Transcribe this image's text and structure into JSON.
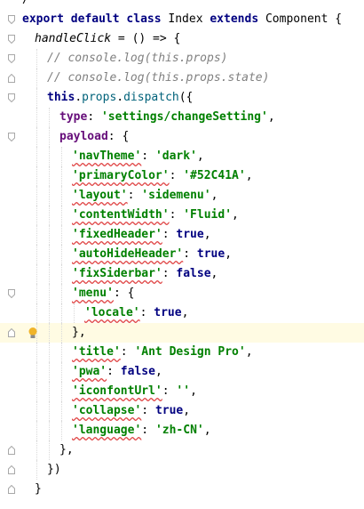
{
  "editor": {
    "active_line_index": 17,
    "lines": [
      {
        "indent": 0,
        "fold": "none",
        "tokens": [
          {
            "t": "/",
            "c": "plain"
          }
        ]
      },
      {
        "indent": 0,
        "fold": "open",
        "tokens": [
          {
            "t": "export",
            "c": "kw"
          },
          {
            "t": " ",
            "c": "plain"
          },
          {
            "t": "default",
            "c": "kw"
          },
          {
            "t": " ",
            "c": "plain"
          },
          {
            "t": "class",
            "c": "kw"
          },
          {
            "t": " Index ",
            "c": "plain"
          },
          {
            "t": "extends",
            "c": "kw"
          },
          {
            "t": " Component {",
            "c": "plain"
          }
        ]
      },
      {
        "indent": 1,
        "fold": "open",
        "tokens": [
          {
            "t": "handleClick",
            "c": "param"
          },
          {
            "t": " = () => {",
            "c": "plain"
          }
        ]
      },
      {
        "indent": 2,
        "fold": "open",
        "tokens": [
          {
            "t": "// console.log(this.props)",
            "c": "comment"
          }
        ]
      },
      {
        "indent": 2,
        "fold": "close",
        "tokens": [
          {
            "t": "// console.log(this.props.state)",
            "c": "comment"
          }
        ]
      },
      {
        "indent": 2,
        "fold": "open",
        "tokens": [
          {
            "t": "this",
            "c": "kw"
          },
          {
            "t": ".",
            "c": "plain"
          },
          {
            "t": "props",
            "c": "fn"
          },
          {
            "t": ".",
            "c": "plain"
          },
          {
            "t": "dispatch",
            "c": "fn"
          },
          {
            "t": "({",
            "c": "plain"
          }
        ]
      },
      {
        "indent": 3,
        "fold": "none",
        "tokens": [
          {
            "t": "type",
            "c": "key"
          },
          {
            "t": ": ",
            "c": "plain"
          },
          {
            "t": "'settings/changeSetting'",
            "c": "str"
          },
          {
            "t": ",",
            "c": "plain"
          }
        ]
      },
      {
        "indent": 3,
        "fold": "open",
        "tokens": [
          {
            "t": "payload",
            "c": "key"
          },
          {
            "t": ": {",
            "c": "plain"
          }
        ]
      },
      {
        "indent": 4,
        "fold": "none",
        "tokens": [
          {
            "t": "'navTheme'",
            "c": "str",
            "w": true
          },
          {
            "t": ": ",
            "c": "plain"
          },
          {
            "t": "'dark'",
            "c": "str"
          },
          {
            "t": ",",
            "c": "plain"
          }
        ]
      },
      {
        "indent": 4,
        "fold": "none",
        "tokens": [
          {
            "t": "'primaryColor'",
            "c": "str",
            "w": true
          },
          {
            "t": ": ",
            "c": "plain"
          },
          {
            "t": "'#52C41A'",
            "c": "str"
          },
          {
            "t": ",",
            "c": "plain"
          }
        ]
      },
      {
        "indent": 4,
        "fold": "none",
        "tokens": [
          {
            "t": "'layout'",
            "c": "str",
            "w": true
          },
          {
            "t": ": ",
            "c": "plain"
          },
          {
            "t": "'sidemenu'",
            "c": "str"
          },
          {
            "t": ",",
            "c": "plain"
          }
        ]
      },
      {
        "indent": 4,
        "fold": "none",
        "tokens": [
          {
            "t": "'contentWidth'",
            "c": "str",
            "w": true
          },
          {
            "t": ": ",
            "c": "plain"
          },
          {
            "t": "'Fluid'",
            "c": "str"
          },
          {
            "t": ",",
            "c": "plain"
          }
        ]
      },
      {
        "indent": 4,
        "fold": "none",
        "tokens": [
          {
            "t": "'fixedHeader'",
            "c": "str",
            "w": true
          },
          {
            "t": ": ",
            "c": "plain"
          },
          {
            "t": "true",
            "c": "kw"
          },
          {
            "t": ",",
            "c": "plain"
          }
        ]
      },
      {
        "indent": 4,
        "fold": "none",
        "tokens": [
          {
            "t": "'autoHideHeader'",
            "c": "str",
            "w": true
          },
          {
            "t": ": ",
            "c": "plain"
          },
          {
            "t": "true",
            "c": "kw"
          },
          {
            "t": ",",
            "c": "plain"
          }
        ]
      },
      {
        "indent": 4,
        "fold": "none",
        "tokens": [
          {
            "t": "'fixSiderbar'",
            "c": "str",
            "w": true
          },
          {
            "t": ": ",
            "c": "plain"
          },
          {
            "t": "false",
            "c": "kw"
          },
          {
            "t": ",",
            "c": "plain"
          }
        ]
      },
      {
        "indent": 4,
        "fold": "open",
        "tokens": [
          {
            "t": "'menu'",
            "c": "str",
            "w": true
          },
          {
            "t": ": {",
            "c": "plain"
          }
        ]
      },
      {
        "indent": 5,
        "fold": "none",
        "tokens": [
          {
            "t": "'locale'",
            "c": "str",
            "w": true
          },
          {
            "t": ": ",
            "c": "plain"
          },
          {
            "t": "true",
            "c": "kw"
          },
          {
            "t": ",",
            "c": "plain"
          }
        ]
      },
      {
        "indent": 4,
        "fold": "close",
        "tokens": [
          {
            "t": "},",
            "c": "plain"
          }
        ]
      },
      {
        "indent": 4,
        "fold": "none",
        "tokens": [
          {
            "t": "'title'",
            "c": "str",
            "w": true
          },
          {
            "t": ": ",
            "c": "plain"
          },
          {
            "t": "'Ant Design Pro'",
            "c": "str"
          },
          {
            "t": ",",
            "c": "plain"
          }
        ]
      },
      {
        "indent": 4,
        "fold": "none",
        "tokens": [
          {
            "t": "'pwa'",
            "c": "str",
            "w": true
          },
          {
            "t": ": ",
            "c": "plain"
          },
          {
            "t": "false",
            "c": "kw"
          },
          {
            "t": ",",
            "c": "plain"
          }
        ]
      },
      {
        "indent": 4,
        "fold": "none",
        "tokens": [
          {
            "t": "'iconfontUrl'",
            "c": "str",
            "w": true
          },
          {
            "t": ": ",
            "c": "plain"
          },
          {
            "t": "''",
            "c": "str"
          },
          {
            "t": ",",
            "c": "plain"
          }
        ]
      },
      {
        "indent": 4,
        "fold": "none",
        "tokens": [
          {
            "t": "'collapse'",
            "c": "str",
            "w": true
          },
          {
            "t": ": ",
            "c": "plain"
          },
          {
            "t": "true",
            "c": "kw"
          },
          {
            "t": ",",
            "c": "plain"
          }
        ]
      },
      {
        "indent": 4,
        "fold": "none",
        "tokens": [
          {
            "t": "'language'",
            "c": "str",
            "w": true
          },
          {
            "t": ": ",
            "c": "plain"
          },
          {
            "t": "'zh-CN'",
            "c": "str"
          },
          {
            "t": ",",
            "c": "plain"
          }
        ]
      },
      {
        "indent": 3,
        "fold": "close",
        "tokens": [
          {
            "t": "},",
            "c": "plain"
          }
        ]
      },
      {
        "indent": 2,
        "fold": "close",
        "tokens": [
          {
            "t": "})",
            "c": "plain"
          }
        ]
      },
      {
        "indent": 1,
        "fold": "close",
        "tokens": [
          {
            "t": "}",
            "c": "plain"
          }
        ]
      }
    ],
    "intention_icon": "lightbulb-icon",
    "colors": {
      "keyword": "#000080",
      "string": "#008000",
      "property": "#660e7a",
      "comment": "#808080",
      "method": "#00627a",
      "active_line": "#fffbe3",
      "typo_underline": "#e04545",
      "bulb": "#f0b429"
    }
  }
}
